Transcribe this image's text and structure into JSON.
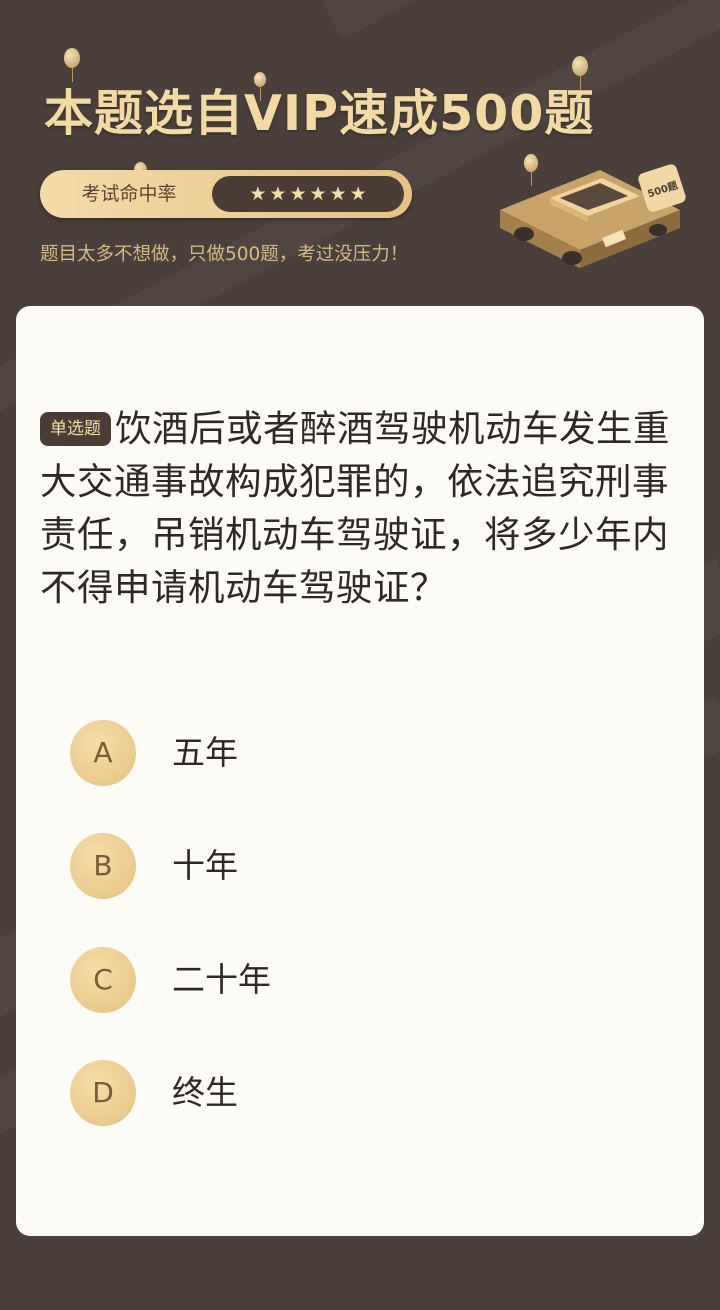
{
  "header": {
    "headline": "本题选自VIP速成500题",
    "rate_label": "考试命中率",
    "stars": [
      "★",
      "★",
      "★",
      "★",
      "★",
      "★"
    ],
    "subtitle": "题目太多不想做，只做500题，考过没压力！",
    "badge_text": "500题"
  },
  "question": {
    "type_badge": "单选题",
    "text": "饮酒后或者醉酒驾驶机动车发生重大交通事故构成犯罪的，依法追究刑事责任，吊销机动车驾驶证，将多少年内不得申请机动车驾驶证？",
    "options": [
      {
        "letter": "A",
        "text": "五年"
      },
      {
        "letter": "B",
        "text": "十年"
      },
      {
        "letter": "C",
        "text": "二十年"
      },
      {
        "letter": "D",
        "text": "终生"
      }
    ]
  },
  "colors": {
    "background": "#4a3f3a",
    "gold": "#f3d9a4",
    "card": "#fdfbf6",
    "dark_badge": "#4b3d36"
  }
}
